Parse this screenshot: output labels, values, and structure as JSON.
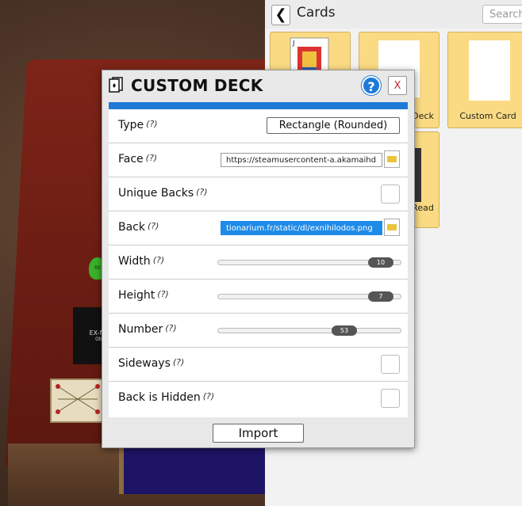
{
  "browser": {
    "title": "Cards",
    "search_placeholder": "Search",
    "tiles": [
      {
        "label": ""
      },
      {
        "label": "Deck"
      },
      {
        "label": "Custom Card"
      },
      {
        "label": "Read"
      }
    ]
  },
  "dialog": {
    "title": "CUSTOM DECK",
    "help_label": "?",
    "close_label": "X",
    "rows": {
      "type": {
        "label": "Type",
        "hint": "(?)",
        "value": "Rectangle (Rounded)"
      },
      "face": {
        "label": "Face",
        "hint": "(?)",
        "value": "https://steamusercontent-a.akamaihd"
      },
      "unique": {
        "label": "Unique Backs",
        "hint": "(?)"
      },
      "back": {
        "label": "Back",
        "hint": "(?)",
        "value": "tionarium.fr/static/dl/exnihilodos.png"
      },
      "width": {
        "label": "Width",
        "hint": "(?)",
        "value": "10",
        "fraction": 0.95
      },
      "height": {
        "label": "Height",
        "hint": "(?)",
        "value": "7",
        "fraction": 0.95
      },
      "number": {
        "label": "Number",
        "hint": "(?)",
        "value": "53",
        "fraction": 0.72
      },
      "sideways": {
        "label": "Sideways",
        "hint": "(?)"
      },
      "hidden": {
        "label": "Back is Hidden",
        "hint": "(?)"
      }
    },
    "import_label": "Import"
  },
  "scene": {
    "card_text": "EX-NI",
    "card_subtext": "Obje",
    "chip_text": "RE"
  },
  "colors": {
    "accent": "#1e7ad6",
    "tile": "#fadb83",
    "selection": "#1e8be8"
  }
}
